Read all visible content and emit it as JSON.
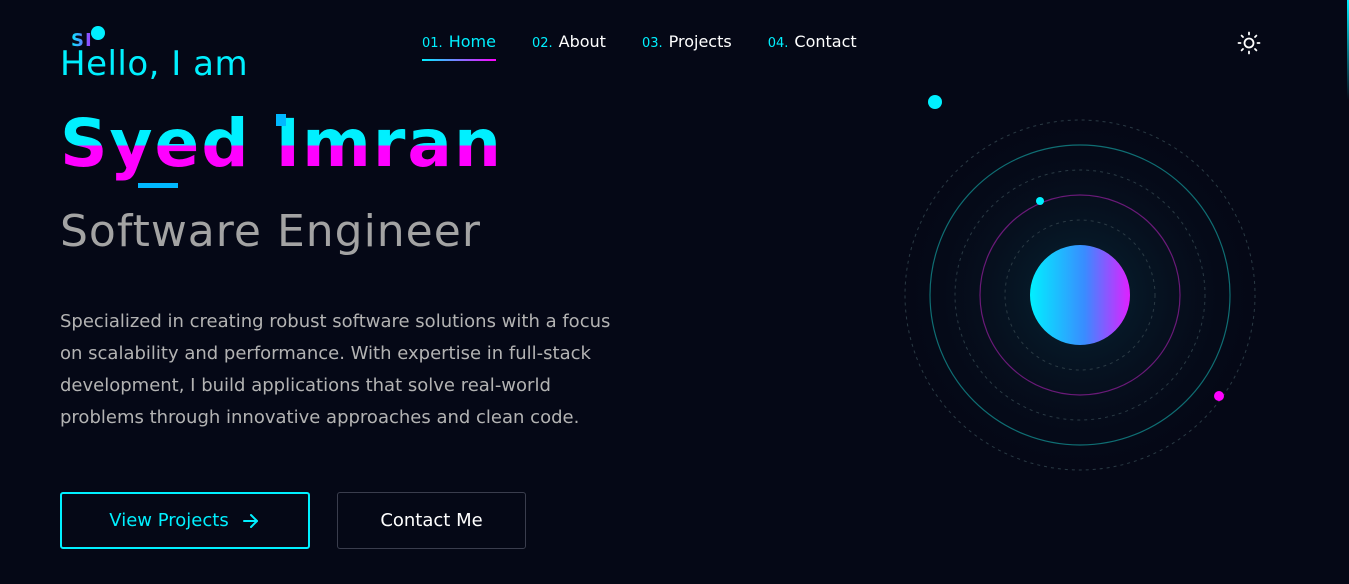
{
  "logo": {
    "text": "SI"
  },
  "nav": {
    "items": [
      {
        "num": "01.",
        "label": "Home",
        "active": true
      },
      {
        "num": "02.",
        "label": "About",
        "active": false
      },
      {
        "num": "03.",
        "label": "Projects",
        "active": false
      },
      {
        "num": "04.",
        "label": "Contact",
        "active": false
      }
    ]
  },
  "theme_toggle": {
    "icon": "sun-icon"
  },
  "hero": {
    "greeting": "Hello, I am",
    "name": "Syed Imran",
    "role": "Software Engineer",
    "description": "Specialized in creating robust software solutions with a focus on scalability and performance. With expertise in full-stack development, I build applications that solve real-world problems through innovative approaches and clean code.",
    "primary_button": "View Projects",
    "primary_button_icon": "arrow-right-icon",
    "secondary_button": "Contact Me"
  },
  "colors": {
    "background": "#050816",
    "accent_cyan": "#00f0ff",
    "accent_magenta": "#ff00ff",
    "muted_text": "#b3b3b3"
  }
}
